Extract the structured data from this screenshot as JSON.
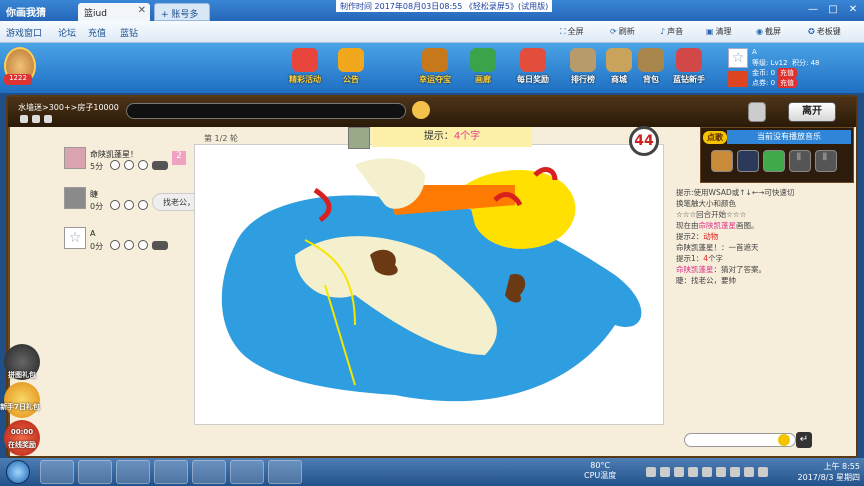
{
  "window": {
    "app_title": "你画我猜",
    "tabs": [
      {
        "label": "篮iud"
      },
      {
        "label": "账号多开"
      }
    ],
    "recording_banner": "制作时间 2017年08月03日08:55 《轻松录屏5》(试用版)",
    "controls": [
      "—",
      "□",
      "✕"
    ]
  },
  "menubar": {
    "links": [
      "游戏窗口",
      "论坛",
      "充值",
      "蓝钻"
    ],
    "tools": [
      {
        "label": "全屏",
        "icon": "fullscreen-icon"
      },
      {
        "label": "刷新",
        "icon": "refresh-icon"
      },
      {
        "label": "声音",
        "icon": "speaker-icon"
      },
      {
        "label": "清理",
        "icon": "trash-icon"
      },
      {
        "label": "截屏",
        "icon": "camera-icon"
      },
      {
        "label": "老板键",
        "icon": "boss-key-icon"
      }
    ]
  },
  "lobby": {
    "user_badge": "1222",
    "nav": [
      "精彩活动",
      "公告",
      "幸运夺宝",
      "画廊",
      "每日奖励",
      "排行榜",
      "商城",
      "背包",
      "蓝钻新手"
    ],
    "profile": {
      "name": "A",
      "level": "等级: Lv12",
      "score": "积分: 48",
      "chip_recharge": "充值",
      "gold": "金币: 0",
      "coin": "点券: 0",
      "chip_recharge2": "充值"
    }
  },
  "game": {
    "room_info": "水墙迷>300+>房子10000",
    "leave_label": "离开",
    "round": "第 1/2 轮",
    "hint_prefix": "提示：",
    "hint_value": "4个字",
    "timer": "44",
    "players": [
      {
        "name": "命陕凯蓬星！",
        "score": "5分",
        "extra": "2"
      },
      {
        "name": "睫",
        "score": "0分"
      },
      {
        "name": "A",
        "score": "0分"
      }
    ],
    "speech_bubble": "找老公，要帅",
    "music_tag": "点歌",
    "music_status": "当前没有播放音乐",
    "chat_log": [
      {
        "parts": [
          {
            "t": "提示:使用WSAD或↑↓←→可快速切"
          }
        ]
      },
      {
        "parts": [
          {
            "t": "换笔触大小和颜色"
          }
        ]
      },
      {
        "parts": [
          {
            "t": "☆☆☆回合开始☆☆☆"
          }
        ]
      },
      {
        "parts": [
          {
            "t": "  现在由"
          },
          {
            "t": "命陕凯蓬星",
            "c": "pink"
          },
          {
            "t": "画图。"
          }
        ]
      },
      {
        "parts": [
          {
            "t": "  提示2："
          },
          {
            "t": "动物",
            "c": "red"
          }
        ]
      },
      {
        "parts": [
          {
            "t": "命陕凯蓬星！：一首遮天"
          }
        ]
      },
      {
        "parts": [
          {
            "t": "  提示1："
          },
          {
            "t": "4",
            "c": "red"
          },
          {
            "t": "个字"
          }
        ]
      },
      {
        "parts": [
          {
            "t": "  "
          },
          {
            "t": "命陕凯蓬星",
            "c": "pink"
          },
          {
            "t": "：猜对了答案。"
          }
        ]
      },
      {
        "parts": [
          {
            "t": "睫：找老公，要帅"
          }
        ]
      }
    ]
  },
  "floating": [
    "拼图礼包",
    "新手7日礼包",
    "在线奖励"
  ],
  "floating_timer": "00:00",
  "taskbar": {
    "temp": "80°C",
    "temp_label": "CPU温度",
    "time": "上午 8:55",
    "date": "2017/8/3 星期四"
  },
  "colors": {
    "title_blue": "#2566b8",
    "lobby_blue": "#1f6fc2",
    "game_frame": "#6a4a22",
    "paper": "#f6eedb",
    "accent_pink": "#e0358a"
  }
}
